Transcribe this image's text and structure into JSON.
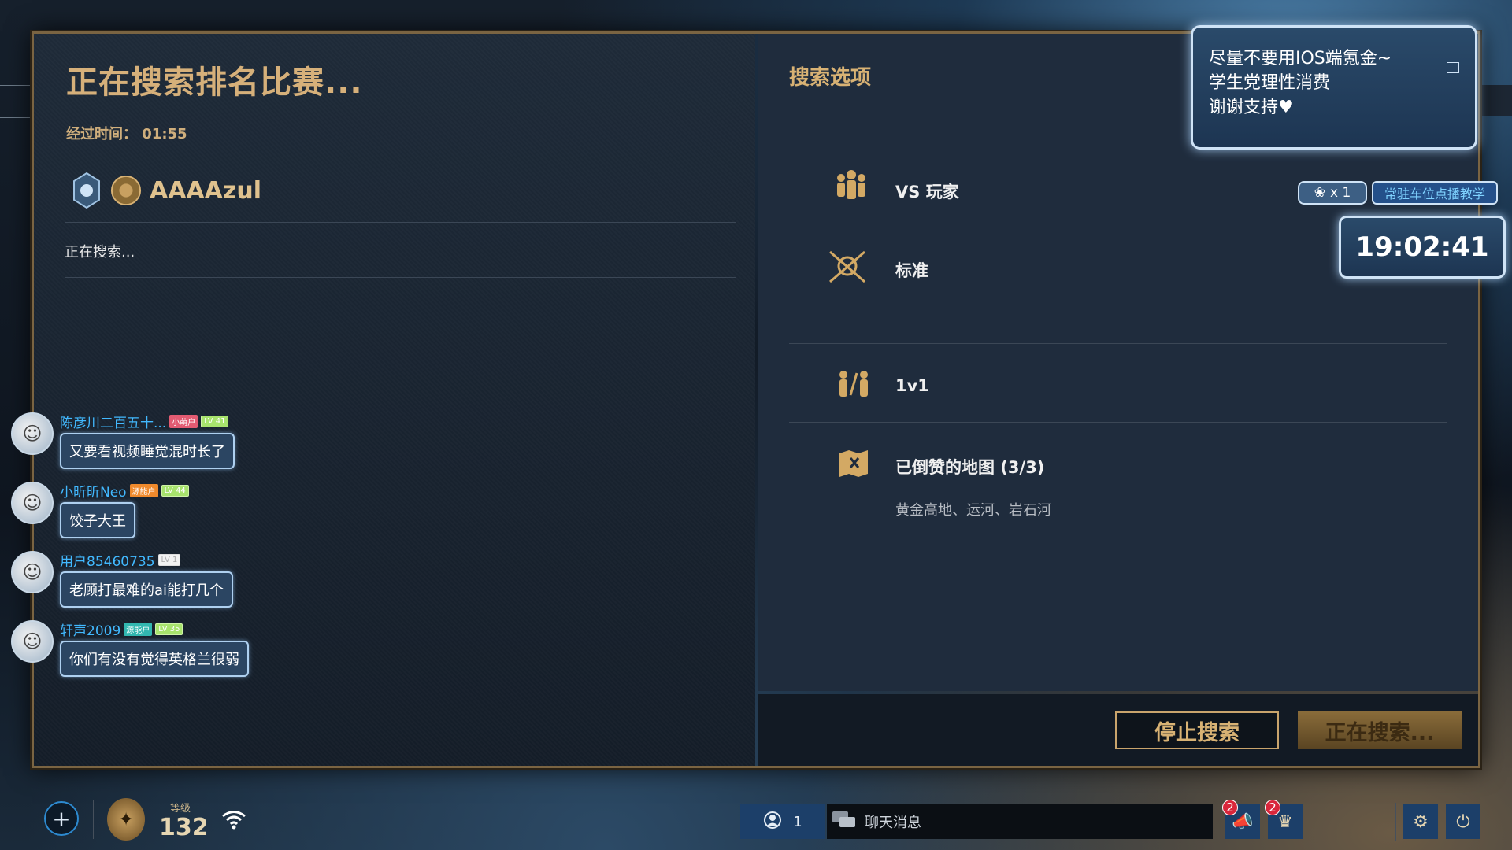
{
  "search": {
    "title": "正在搜索排名比赛...",
    "elapsed_label": "经过时间：",
    "elapsed_time": "01:55",
    "player_name": "AAAAzul",
    "status": "正在搜索..."
  },
  "chat": [
    {
      "user": "陈彦川二百五十...",
      "tags": [
        "小萌户",
        "LV 41"
      ],
      "text": "又要看视频睡觉混时长了"
    },
    {
      "user": "小昕昕Neo",
      "tags": [
        "源能户",
        "LV 44"
      ],
      "text": "饺子大王"
    },
    {
      "user": "用户85460735",
      "tags": [
        "LV 1"
      ],
      "text": "老顾打最难的ai能打几个"
    },
    {
      "user": "轩声2009",
      "tags": [
        "源能户",
        "LV 35"
      ],
      "text": "你们有没有觉得英格兰很弱"
    }
  ],
  "options": {
    "title": "搜索选项",
    "mode": "VS 玩家",
    "queue": "标准",
    "format": "1v1",
    "vetoed_maps_label": "已倒赞的地图 (3/3)",
    "vetoed_maps": "黄金高地、运河、岩石河"
  },
  "buttons": {
    "stop": "停止搜索",
    "searching": "正在搜索..."
  },
  "overlay": {
    "notice_lines": [
      "尽量不要用IOS端氪金~",
      "学生党理性消费",
      "谢谢支持♥"
    ],
    "clock": "19:02:41",
    "gift_count": "x 1",
    "teach_label": "常驻车位点播教学"
  },
  "bottom": {
    "level_label": "等级",
    "level_value": "132",
    "friends_online": "1",
    "chat_placeholder": "聊天消息",
    "notif_1": "2",
    "notif_2": "2"
  },
  "icons": {
    "add": "plus-icon",
    "wifi": "wifi-icon",
    "settings": "gear-icon",
    "power": "power-icon"
  }
}
